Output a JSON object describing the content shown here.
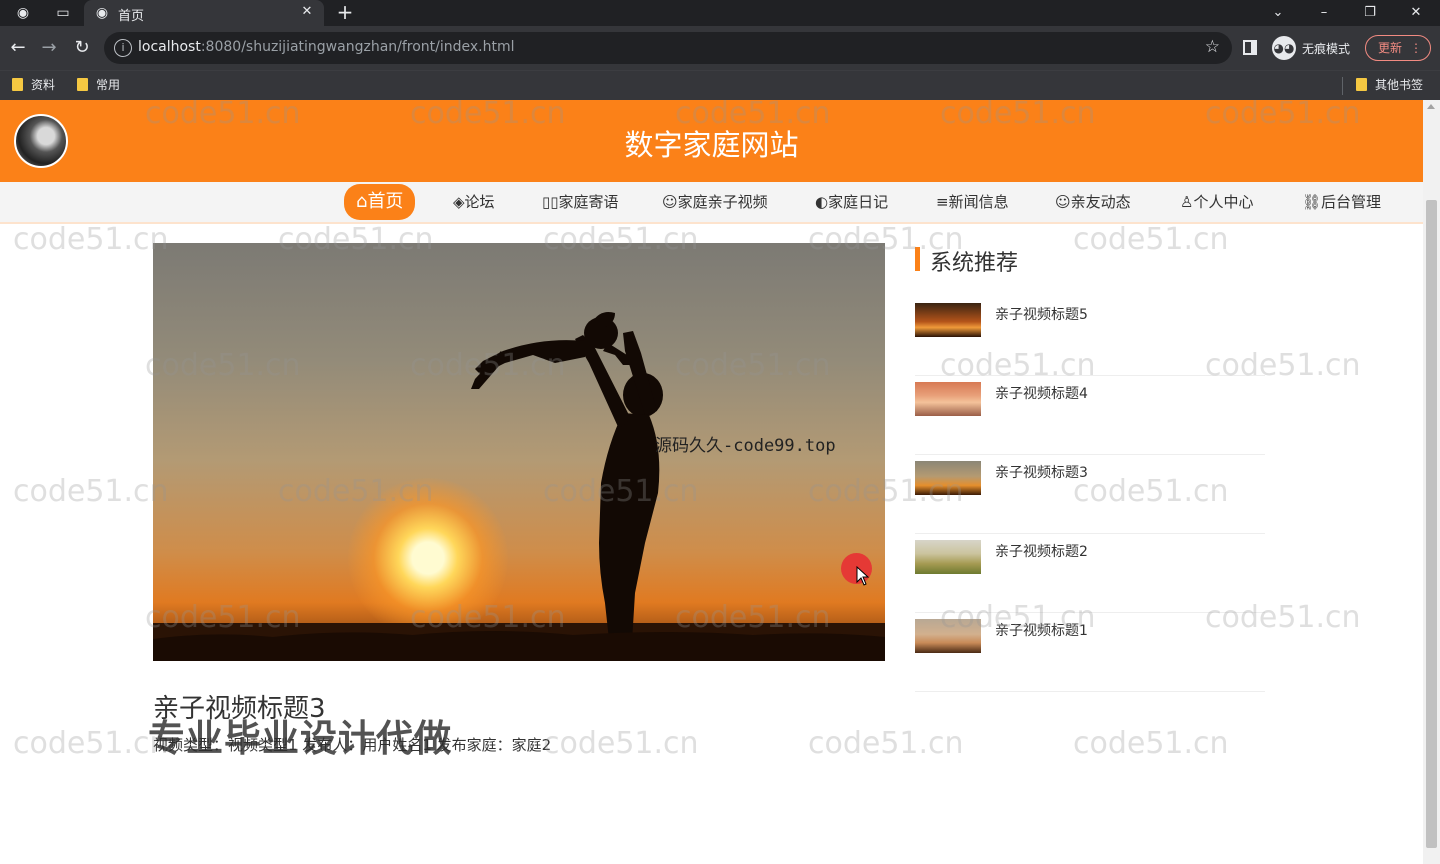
{
  "browser": {
    "tab_title": "首页",
    "url_host": "localhost",
    "url_rest": ":8080/shuzijiatingwangzhan/front/index.html",
    "incognito_label": "无痕模式",
    "update_label": "更新",
    "bookmarks": [
      "资料",
      "常用"
    ],
    "other_bookmarks": "其他书签"
  },
  "site": {
    "title": "数字家庭网站",
    "nav": [
      {
        "icon": "home-icon",
        "glyph": "⌂",
        "label": "首页"
      },
      {
        "icon": "forum-icon",
        "glyph": "◈",
        "label": "论坛"
      },
      {
        "icon": "message-icon",
        "glyph": "▯▯",
        "label": "家庭寄语"
      },
      {
        "icon": "video-icon",
        "glyph": "☺",
        "label": "家庭亲子视频"
      },
      {
        "icon": "diary-icon",
        "glyph": "◐",
        "label": "家庭日记"
      },
      {
        "icon": "news-icon",
        "glyph": "≡",
        "label": "新闻信息"
      },
      {
        "icon": "friends-icon",
        "glyph": "☺",
        "label": "亲友动态"
      },
      {
        "icon": "user-icon",
        "glyph": "♙",
        "label": "个人中心"
      },
      {
        "icon": "link-icon",
        "glyph": "⛓",
        "label": "后台管理"
      }
    ]
  },
  "recommend": {
    "title": "系统推荐",
    "items": [
      {
        "title": "亲子视频标题5"
      },
      {
        "title": "亲子视频标题4"
      },
      {
        "title": "亲子视频标题3"
      },
      {
        "title": "亲子视频标题2"
      },
      {
        "title": "亲子视频标题1"
      }
    ]
  },
  "detail": {
    "title": "亲子视频标题3",
    "meta": "视频类型：视频类型1  发布人：用户姓名1  发布家庭：家庭2"
  },
  "watermarks": {
    "code51": "code51.cn",
    "code99": "源码久久-code99.top",
    "ad": "专业毕业设计代做"
  },
  "colors": {
    "brand": "#fb8118",
    "update": "#f28b82"
  }
}
